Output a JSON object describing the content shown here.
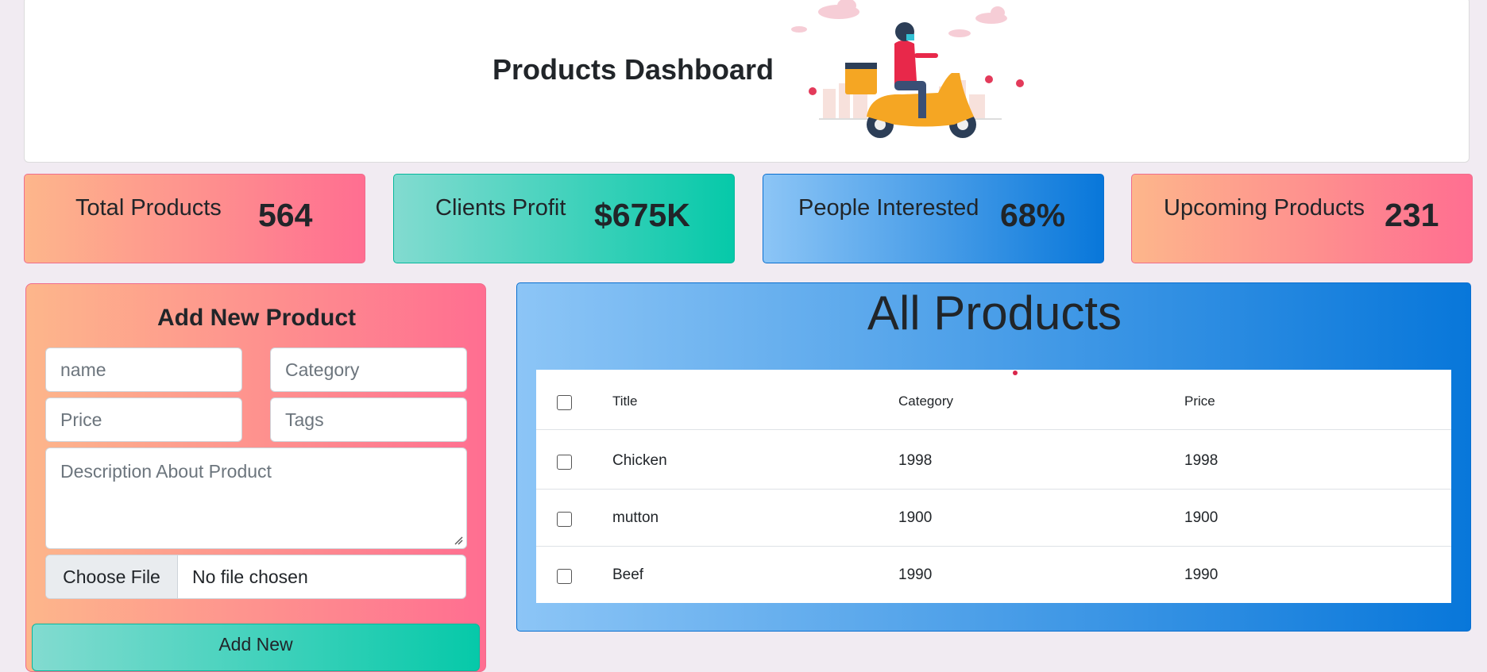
{
  "header": {
    "title": "Products Dashboard"
  },
  "stats": [
    {
      "label": "Total Products",
      "value": "564"
    },
    {
      "label": "Clients Profit",
      "value": "$675K"
    },
    {
      "label": "People Interested",
      "value": "68%"
    },
    {
      "label": "Upcoming Products",
      "value": "231"
    }
  ],
  "form": {
    "title": "Add New Product",
    "name_placeholder": "name",
    "category_placeholder": "Category",
    "price_placeholder": "Price",
    "tags_placeholder": "Tags",
    "description_placeholder": "Description About Product",
    "file_button": "Choose File",
    "file_status": "No file chosen",
    "submit_label": "Add New"
  },
  "products": {
    "title": "All Products",
    "columns": [
      "Title",
      "Category",
      "Price"
    ],
    "rows": [
      {
        "title": "Chicken",
        "category": "1998",
        "price": "1998"
      },
      {
        "title": "mutton",
        "category": "1900",
        "price": "1900"
      },
      {
        "title": "Beef",
        "category": "1990",
        "price": "1990"
      }
    ]
  },
  "colors": {
    "pink_start": "#fdb68b",
    "pink_end": "#ff6e91",
    "teal_start": "#82dbd0",
    "teal_end": "#06c9a9",
    "blue_start": "#8cc5f6",
    "blue_end": "#0877da"
  },
  "icons": [
    "delivery-scooter-illustration",
    "resize-handle-icon"
  ]
}
